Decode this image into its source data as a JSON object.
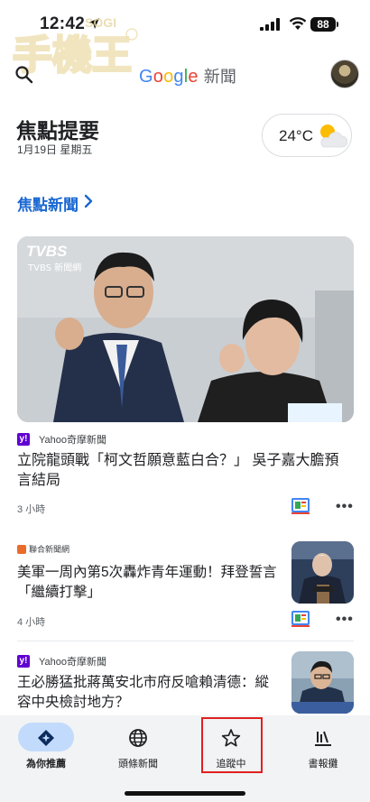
{
  "status_bar": {
    "time": "12:42",
    "battery": "88"
  },
  "watermark": {
    "text": "手機王",
    "brand": "SOGI"
  },
  "header": {
    "logo_google": [
      "G",
      "o",
      "o",
      "g",
      "l",
      "e"
    ],
    "logo_news": "新聞"
  },
  "briefing": {
    "title": "焦點提要",
    "date": "1月19日 星期五",
    "weather_temp": "24°C"
  },
  "section": {
    "label": "焦點新聞"
  },
  "hero": {
    "image_label": "TVBS 新聞網",
    "source": "Yahoo奇摩新聞",
    "source_badge": "y!",
    "title": "立院龍頭戰「柯文哲願意藍白合？」 吳子嘉大膽預言結局",
    "time": "3 小時"
  },
  "stories": [
    {
      "source": "聯合新聞網",
      "title": "美軍一周內第5次轟炸青年運動！拜登誓言「繼續打擊」",
      "time": "4 小時"
    },
    {
      "source": "Yahoo奇摩新聞",
      "source_badge": "y!",
      "title": "王必勝猛批蔣萬安北市府反嗆賴清德：縱容中央檢討地方？",
      "time": ""
    }
  ],
  "bottom_nav": {
    "items": [
      {
        "label": "為你推薦",
        "icon": "for-you-icon",
        "active": true
      },
      {
        "label": "頭條新聞",
        "icon": "globe-icon",
        "active": false
      },
      {
        "label": "追蹤中",
        "icon": "star-icon",
        "active": false
      },
      {
        "label": "書報攤",
        "icon": "newsstand-icon",
        "active": false
      }
    ]
  },
  "colors": {
    "accent_blue": "#1967d2",
    "nav_background": "#f1f3f4",
    "active_pill": "#c2dbfc",
    "highlight_red": "#e02020",
    "yahoo_purple": "#6001d2"
  }
}
